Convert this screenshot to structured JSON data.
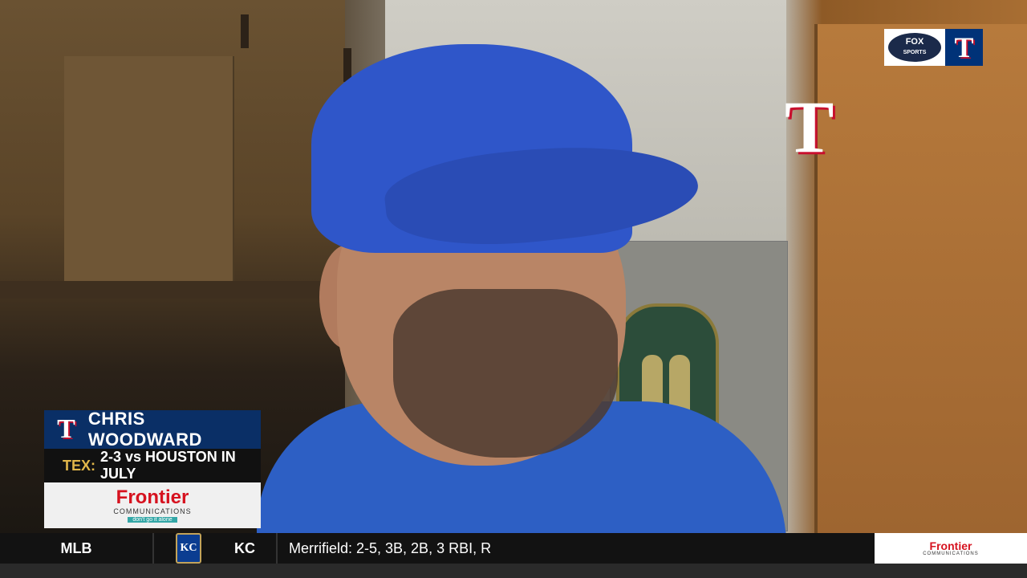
{
  "broadcast": {
    "network_bug": {
      "network_top": "FOX",
      "network_bottom": "SPORTS",
      "team_logo_letter": "T"
    }
  },
  "lower_third": {
    "team_logo_letter": "T",
    "name": "CHRIS WOODWARD",
    "stat_team": "TEX:",
    "stat_text": "2-3 vs HOUSTON IN JULY",
    "sponsor": {
      "name": "Frontier",
      "subtitle": "COMMUNICATIONS",
      "tagline": "don't go it alone"
    }
  },
  "ticker": {
    "league": "MLB",
    "team_logo_letters": "KC",
    "team": "KC",
    "text": "Merrifield: 2-5, 3B, 2B, 3 RBI, R",
    "sponsor": {
      "name": "Frontier",
      "subtitle": "COMMUNICATIONS"
    }
  },
  "scene": {
    "cap_logo_letter": "T"
  },
  "colors": {
    "rangers_blue": "#003278",
    "rangers_red": "#c8102e",
    "stat_gold": "#e1b64a",
    "frontier_red": "#d6121f"
  }
}
